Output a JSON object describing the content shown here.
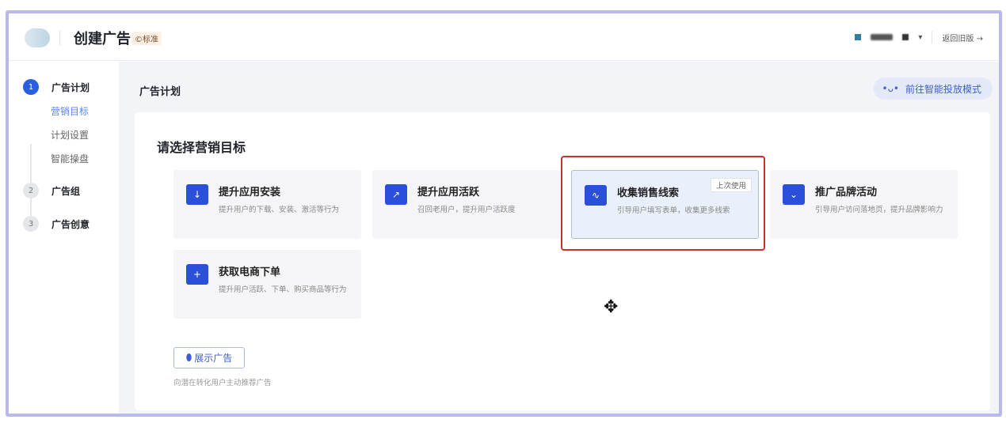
{
  "header": {
    "title": "创建广告",
    "badge": "©标准",
    "back_label": "返回旧版 →"
  },
  "sidebar": {
    "steps": [
      {
        "num": "1",
        "label": "广告计划",
        "subitems": [
          "营销目标",
          "计划设置",
          "智能操盘"
        ]
      },
      {
        "num": "2",
        "label": "广告组"
      },
      {
        "num": "3",
        "label": "广告创意"
      }
    ]
  },
  "main": {
    "title": "广告计划",
    "smart_button": "前往智能投放模式",
    "panel_title": "请选择营销目标",
    "cards": [
      {
        "title": "提升应用安装",
        "desc": "提升用户的下载、安装、激活等行为",
        "icon": "download-icon"
      },
      {
        "title": "提升应用活跃",
        "desc": "召回老用户，提升用户活跃度",
        "icon": "monitor-chart-icon"
      },
      {
        "title": "收集销售线索",
        "desc": "引导用户填写表单，收集更多线索",
        "icon": "folder-wave-icon",
        "tag": "上次使用"
      },
      {
        "title": "推广品牌活动",
        "desc": "引导用户访问落地页，提升品牌影响力",
        "icon": "brand-chevron-icon"
      },
      {
        "title": "获取电商下单",
        "desc": "提升用户活跃、下单、购买商品等行为",
        "icon": "cart-icon"
      }
    ],
    "show_ad_button": "展示广告",
    "show_ad_caption": "向潜在转化用户主动推荐广告"
  },
  "colors": {
    "accent": "#2a5fe0",
    "highlight": "#c8302f"
  }
}
